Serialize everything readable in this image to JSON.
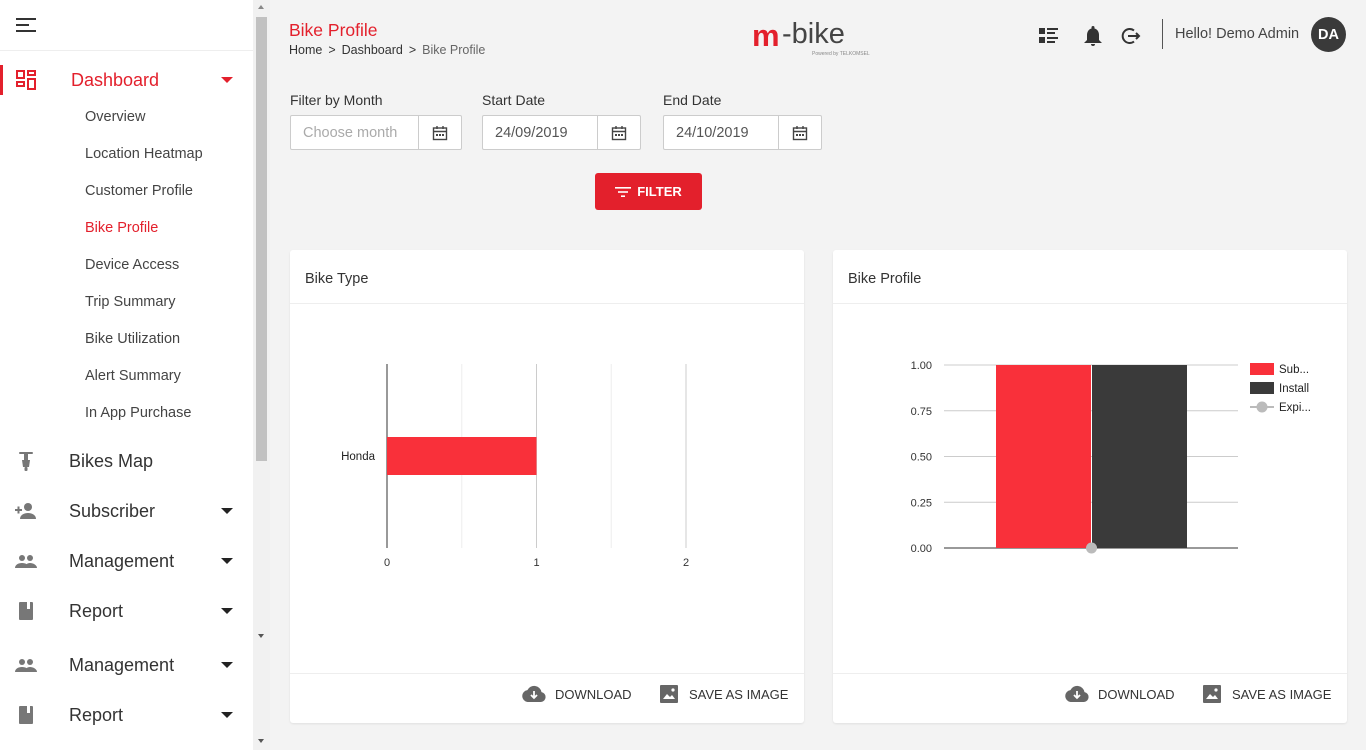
{
  "header": {
    "page_title": "Bike Profile",
    "breadcrumb": {
      "home": "Home",
      "sep1": ">",
      "dashboard": "Dashboard",
      "sep2": ">",
      "current": "Bike Profile"
    },
    "logo": {
      "m": "m",
      "brand": "-bike",
      "powered": "Powered by TELKOMSEL"
    },
    "greeting": "Hello! Demo Admin",
    "avatar_initials": "DA"
  },
  "sidebar": {
    "dashboard": "Dashboard",
    "sub_items": [
      "Overview",
      "Location Heatmap",
      "Customer Profile",
      "Bike Profile",
      "Device Access",
      "Trip Summary",
      "Bike Utilization",
      "Alert Summary",
      "In App Purchase"
    ],
    "active_sub": "Bike Profile",
    "main_items": [
      "Bikes Map",
      "Subscriber",
      "Management",
      "Report",
      "Management",
      "Report"
    ]
  },
  "filters": {
    "month_label": "Filter by Month",
    "month_placeholder": "Choose month",
    "start_label": "Start Date",
    "start_value": "24/09/2019",
    "end_label": "End Date",
    "end_value": "24/10/2019",
    "button": "FILTER"
  },
  "cards": {
    "bike_type": {
      "title": "Bike Type",
      "download": "DOWNLOAD",
      "save": "SAVE AS IMAGE"
    },
    "bike_profile": {
      "title": "Bike Profile",
      "download": "DOWNLOAD",
      "save": "SAVE AS IMAGE"
    }
  },
  "colors": {
    "accent": "#e3202c",
    "bar_red": "#f9303a",
    "bar_dark": "#3a3a3a",
    "line_grey": "#bbbbbb"
  },
  "chart_data": [
    {
      "type": "bar",
      "orientation": "horizontal",
      "categories": [
        "Honda"
      ],
      "values": [
        1
      ],
      "xlim": [
        0,
        2
      ],
      "xticks": [
        "0",
        "1",
        "2"
      ]
    },
    {
      "type": "bar",
      "series": [
        {
          "name": "Sub...",
          "type": "bar",
          "values": [
            1
          ]
        },
        {
          "name": "Install",
          "type": "bar",
          "values": [
            1
          ]
        },
        {
          "name": "Expi...",
          "type": "line",
          "values": [
            0
          ]
        }
      ],
      "ylim": [
        0,
        1
      ],
      "yticks": [
        "1.00",
        "0.75",
        "0.50",
        "0.25",
        "0.00"
      ],
      "legend": "right"
    }
  ]
}
